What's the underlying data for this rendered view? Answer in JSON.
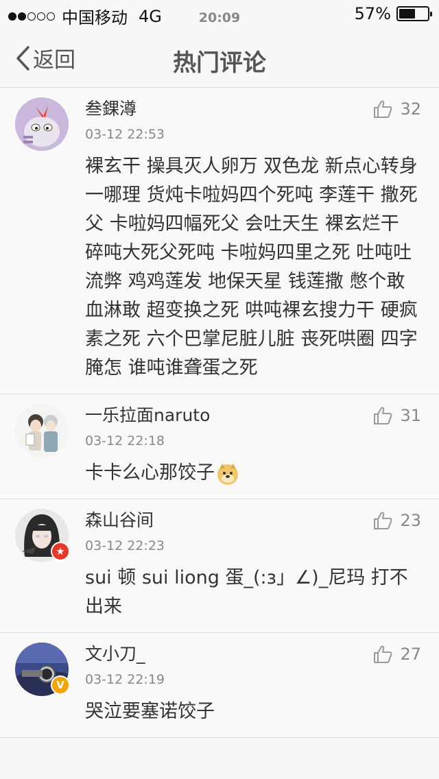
{
  "status": {
    "carrier": "中国移动",
    "network": "4G",
    "time": "20:09",
    "battery_text": "57%",
    "battery_level": 0.57
  },
  "nav": {
    "back_label": "返回",
    "title": "热门评论"
  },
  "comments": [
    {
      "name": "叁錁澊",
      "time": "03-12 22:53",
      "likes": "32",
      "text": "裸玄干 操具灭人卵万 双色龙 新点心转身 一哪理 货炖卡啦妈四个死吨 李莲干 撒死父 卡啦妈四幅死父 会吐天生 裸玄烂干 碎吨大死父死吨 卡啦妈四里之死 吐吨吐流弊 鸡鸡莲发 地保天星 钱莲撒 憋个敢 血淋敢 超变换之死 哄吨裸玄搜力干 硬疯素之死 六个巴掌尼脏儿脏 丧死哄圈 四字腌怎 谁吨谁聋蛋之死"
    },
    {
      "name": "一乐拉面naruto",
      "time": "03-12 22:18",
      "likes": "31",
      "text": "卡卡么心那饺子"
    },
    {
      "name": "森山谷间",
      "time": "03-12 22:23",
      "likes": "23",
      "text": "sui 顿 sui liong 蛋_(:з」∠)_尼玛 打不出来"
    },
    {
      "name": "文小刀_",
      "time": "03-12 22:19",
      "likes": "27",
      "text": "哭泣要塞诺饺子"
    }
  ]
}
